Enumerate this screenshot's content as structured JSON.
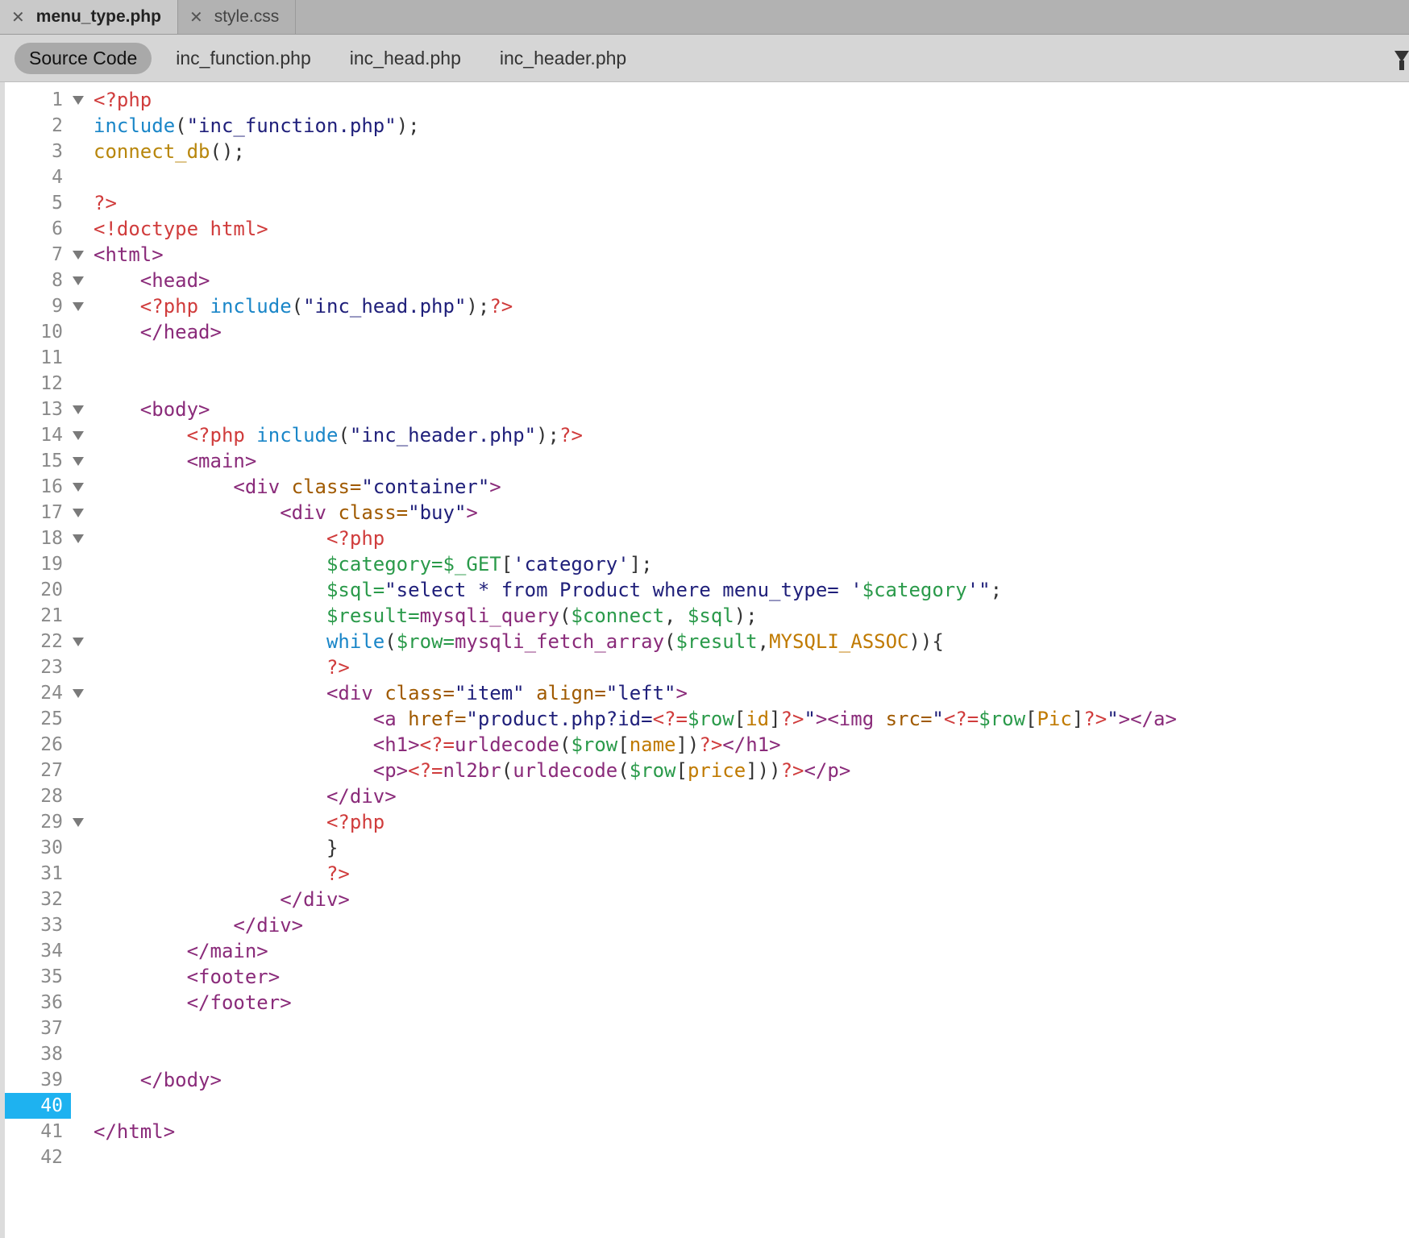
{
  "tabs": [
    {
      "label": "menu_type.php",
      "active": true
    },
    {
      "label": "style.css",
      "active": false
    }
  ],
  "related_files": [
    "Source Code",
    "inc_function.php",
    "inc_head.php",
    "inc_header.php"
  ],
  "current_line": 40,
  "lines": [
    {
      "n": "1",
      "fold": true,
      "t": [
        [
          "php",
          "<?php"
        ]
      ]
    },
    {
      "n": "2",
      "fold": false,
      "t": [
        [
          "kw",
          "include"
        ],
        [
          "p",
          "("
        ],
        [
          "str",
          "\"inc_function.php\""
        ],
        [
          "p",
          ");"
        ]
      ]
    },
    {
      "n": "3",
      "fold": false,
      "t": [
        [
          "fn",
          "connect_db"
        ],
        [
          "p",
          "();"
        ]
      ]
    },
    {
      "n": "4",
      "fold": false,
      "t": []
    },
    {
      "n": "5",
      "fold": false,
      "t": [
        [
          "php",
          "?>"
        ]
      ]
    },
    {
      "n": "6",
      "fold": false,
      "t": [
        [
          "php",
          "<!doctype html>"
        ]
      ]
    },
    {
      "n": "7",
      "fold": true,
      "t": [
        [
          "tag",
          "<html>"
        ]
      ]
    },
    {
      "n": "8",
      "fold": true,
      "t": [
        [
          "p",
          "    "
        ],
        [
          "tag",
          "<head>"
        ]
      ]
    },
    {
      "n": "9",
      "fold": true,
      "t": [
        [
          "p",
          "    "
        ],
        [
          "php",
          "<?php "
        ],
        [
          "kw",
          "include"
        ],
        [
          "p",
          "("
        ],
        [
          "str",
          "\"inc_head.php\""
        ],
        [
          "p",
          ");"
        ],
        [
          "php",
          "?>"
        ]
      ]
    },
    {
      "n": "10",
      "fold": false,
      "t": [
        [
          "p",
          "    "
        ],
        [
          "tag",
          "</head>"
        ]
      ]
    },
    {
      "n": "11",
      "fold": false,
      "t": []
    },
    {
      "n": "12",
      "fold": false,
      "t": []
    },
    {
      "n": "13",
      "fold": true,
      "t": [
        [
          "p",
          "    "
        ],
        [
          "tag",
          "<body>"
        ]
      ]
    },
    {
      "n": "14",
      "fold": true,
      "t": [
        [
          "p",
          "        "
        ],
        [
          "php",
          "<?php "
        ],
        [
          "kw",
          "include"
        ],
        [
          "p",
          "("
        ],
        [
          "str",
          "\"inc_header.php\""
        ],
        [
          "p",
          ");"
        ],
        [
          "php",
          "?>"
        ]
      ]
    },
    {
      "n": "15",
      "fold": true,
      "t": [
        [
          "p",
          "        "
        ],
        [
          "tag",
          "<main>"
        ]
      ]
    },
    {
      "n": "16",
      "fold": true,
      "t": [
        [
          "p",
          "            "
        ],
        [
          "tag",
          "<div "
        ],
        [
          "attr",
          "class="
        ],
        [
          "str",
          "\"container\""
        ],
        [
          "tag",
          ">"
        ]
      ]
    },
    {
      "n": "17",
      "fold": true,
      "t": [
        [
          "p",
          "                "
        ],
        [
          "tag",
          "<div "
        ],
        [
          "attr",
          "class="
        ],
        [
          "str",
          "\"buy\""
        ],
        [
          "tag",
          ">"
        ]
      ]
    },
    {
      "n": "18",
      "fold": true,
      "t": [
        [
          "p",
          "                    "
        ],
        [
          "php",
          "<?php"
        ]
      ]
    },
    {
      "n": "19",
      "fold": false,
      "t": [
        [
          "p",
          "                    "
        ],
        [
          "var",
          "$category=$_GET"
        ],
        [
          "p",
          "["
        ],
        [
          "str",
          "'category'"
        ],
        [
          "p",
          "];"
        ]
      ]
    },
    {
      "n": "20",
      "fold": false,
      "t": [
        [
          "p",
          "                    "
        ],
        [
          "var",
          "$sql="
        ],
        [
          "str",
          "\"select * from Product where menu_type= '"
        ],
        [
          "var",
          "$category"
        ],
        [
          "str",
          "'\""
        ],
        [
          "p",
          ";"
        ]
      ]
    },
    {
      "n": "21",
      "fold": false,
      "t": [
        [
          "p",
          "                    "
        ],
        [
          "var",
          "$result="
        ],
        [
          "tag",
          "mysqli_query"
        ],
        [
          "p",
          "("
        ],
        [
          "var",
          "$connect"
        ],
        [
          "p",
          ", "
        ],
        [
          "var",
          "$sql"
        ],
        [
          "p",
          ");"
        ]
      ]
    },
    {
      "n": "22",
      "fold": true,
      "t": [
        [
          "p",
          "                    "
        ],
        [
          "kw",
          "while"
        ],
        [
          "p",
          "("
        ],
        [
          "var",
          "$row="
        ],
        [
          "tag",
          "mysqli_fetch_array"
        ],
        [
          "p",
          "("
        ],
        [
          "var",
          "$result"
        ],
        [
          "p",
          ","
        ],
        [
          "const",
          "MYSQLI_ASSOC"
        ],
        [
          "p",
          "))"
        ],
        [
          "p",
          "{"
        ]
      ]
    },
    {
      "n": "23",
      "fold": false,
      "t": [
        [
          "p",
          "                    "
        ],
        [
          "php",
          "?>"
        ]
      ]
    },
    {
      "n": "24",
      "fold": true,
      "t": [
        [
          "p",
          "                    "
        ],
        [
          "tag",
          "<div "
        ],
        [
          "attr",
          "class="
        ],
        [
          "str",
          "\"item\" "
        ],
        [
          "attr",
          "align="
        ],
        [
          "str",
          "\"left\""
        ],
        [
          "tag",
          ">"
        ]
      ]
    },
    {
      "n": "25",
      "fold": false,
      "t": [
        [
          "p",
          "                        "
        ],
        [
          "tag",
          "<a "
        ],
        [
          "attr",
          "href="
        ],
        [
          "str",
          "\"product.php?id="
        ],
        [
          "php",
          "<?="
        ],
        [
          "var",
          "$row"
        ],
        [
          "p",
          "["
        ],
        [
          "const",
          "id"
        ],
        [
          "p",
          "]"
        ],
        [
          "php",
          "?>"
        ],
        [
          "str",
          "\""
        ],
        [
          "tag",
          "><img "
        ],
        [
          "attr",
          "src="
        ],
        [
          "str",
          "\""
        ],
        [
          "php",
          "<?="
        ],
        [
          "var",
          "$row"
        ],
        [
          "p",
          "["
        ],
        [
          "const",
          "Pic"
        ],
        [
          "p",
          "]"
        ],
        [
          "php",
          "?>"
        ],
        [
          "str",
          "\""
        ],
        [
          "tag",
          "></a>"
        ]
      ]
    },
    {
      "n": "26",
      "fold": false,
      "t": [
        [
          "p",
          "                        "
        ],
        [
          "tag",
          "<h1>"
        ],
        [
          "php",
          "<?="
        ],
        [
          "tag",
          "urldecode"
        ],
        [
          "p",
          "("
        ],
        [
          "var",
          "$row"
        ],
        [
          "p",
          "["
        ],
        [
          "const",
          "name"
        ],
        [
          "p",
          "])"
        ],
        [
          "php",
          "?>"
        ],
        [
          "tag",
          "</h1>"
        ]
      ]
    },
    {
      "n": "27",
      "fold": false,
      "t": [
        [
          "p",
          "                        "
        ],
        [
          "tag",
          "<p>"
        ],
        [
          "php",
          "<?="
        ],
        [
          "tag",
          "nl2br"
        ],
        [
          "p",
          "("
        ],
        [
          "tag",
          "urldecode"
        ],
        [
          "p",
          "("
        ],
        [
          "var",
          "$row"
        ],
        [
          "p",
          "["
        ],
        [
          "const",
          "price"
        ],
        [
          "p",
          "]))"
        ],
        [
          "php",
          "?>"
        ],
        [
          "tag",
          "</p>"
        ]
      ]
    },
    {
      "n": "28",
      "fold": false,
      "t": [
        [
          "p",
          "                    "
        ],
        [
          "tag",
          "</div>"
        ]
      ]
    },
    {
      "n": "29",
      "fold": true,
      "t": [
        [
          "p",
          "                    "
        ],
        [
          "php",
          "<?php"
        ]
      ]
    },
    {
      "n": "30",
      "fold": false,
      "t": [
        [
          "p",
          "                    }"
        ]
      ]
    },
    {
      "n": "31",
      "fold": false,
      "t": [
        [
          "p",
          "                    "
        ],
        [
          "php",
          "?>"
        ]
      ]
    },
    {
      "n": "32",
      "fold": false,
      "t": [
        [
          "p",
          "                "
        ],
        [
          "tag",
          "</div>"
        ]
      ]
    },
    {
      "n": "33",
      "fold": false,
      "t": [
        [
          "p",
          "            "
        ],
        [
          "tag",
          "</div>"
        ]
      ]
    },
    {
      "n": "34",
      "fold": false,
      "t": [
        [
          "p",
          "        "
        ],
        [
          "tag",
          "</main>"
        ]
      ]
    },
    {
      "n": "35",
      "fold": false,
      "t": [
        [
          "p",
          "        "
        ],
        [
          "tag",
          "<footer>"
        ]
      ]
    },
    {
      "n": "36",
      "fold": false,
      "t": [
        [
          "p",
          "        "
        ],
        [
          "tag",
          "</footer>"
        ]
      ]
    },
    {
      "n": "37",
      "fold": false,
      "t": []
    },
    {
      "n": "38",
      "fold": false,
      "t": []
    },
    {
      "n": "39",
      "fold": false,
      "t": [
        [
          "p",
          "    "
        ],
        [
          "tag",
          "</body>"
        ]
      ]
    },
    {
      "n": "40",
      "fold": false,
      "t": []
    },
    {
      "n": "41",
      "fold": false,
      "t": [
        [
          "tag",
          "</html>"
        ]
      ]
    },
    {
      "n": "42",
      "fold": false,
      "t": []
    }
  ]
}
